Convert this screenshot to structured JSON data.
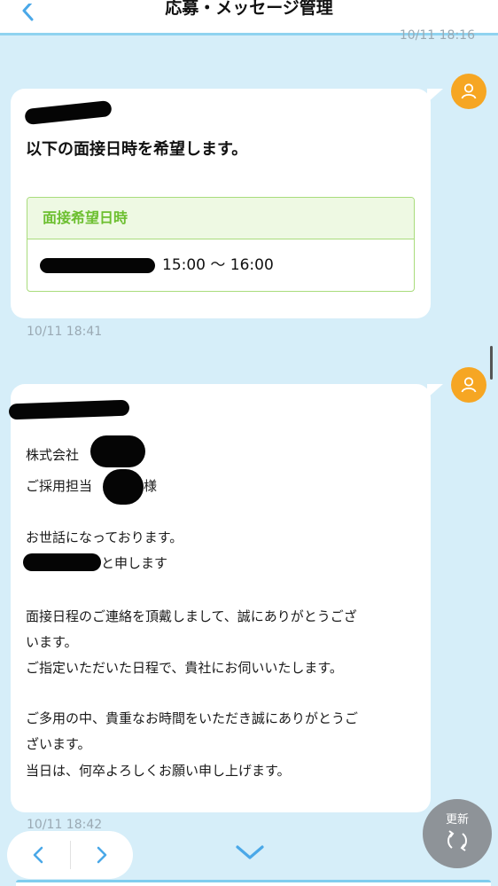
{
  "header": {
    "title": "応募・メッセージ管理",
    "back_icon": "chevron-left-icon"
  },
  "messages": [
    {
      "timestamp_above": "10/11 18:16",
      "title": "以下の面接日時を希望します。",
      "box_header": "面接希望日時",
      "box_time": "15:00 ～ 16:00",
      "timestamp": "10/11 18:41"
    },
    {
      "lines": [
        "株式会社",
        "ご採用担当",
        "様",
        "お世話になっております。",
        "と申します",
        "面接日程のご連絡を頂戴しまして、誠にありがとうござ",
        "います。",
        "ご指定いただいた日程で、貴社にお伺いいたします。",
        "ご多用の中、貴重なお時間をいただき誠にありがとうご",
        "ざいます。",
        "当日は、何卒よろしくお願い申し上げます。"
      ],
      "timestamp": "10/11 18:42"
    }
  ],
  "controls": {
    "refresh_label": "更新",
    "refresh_icon": "refresh-icon",
    "prev_icon": "chevron-left-icon",
    "next_icon": "chevron-right-icon",
    "down_icon": "chevron-down-icon"
  },
  "colors": {
    "background": "#d6eef9",
    "accent": "#4aa8e8",
    "avatar": "#f6a623",
    "box_green": "#6cbf2f"
  }
}
